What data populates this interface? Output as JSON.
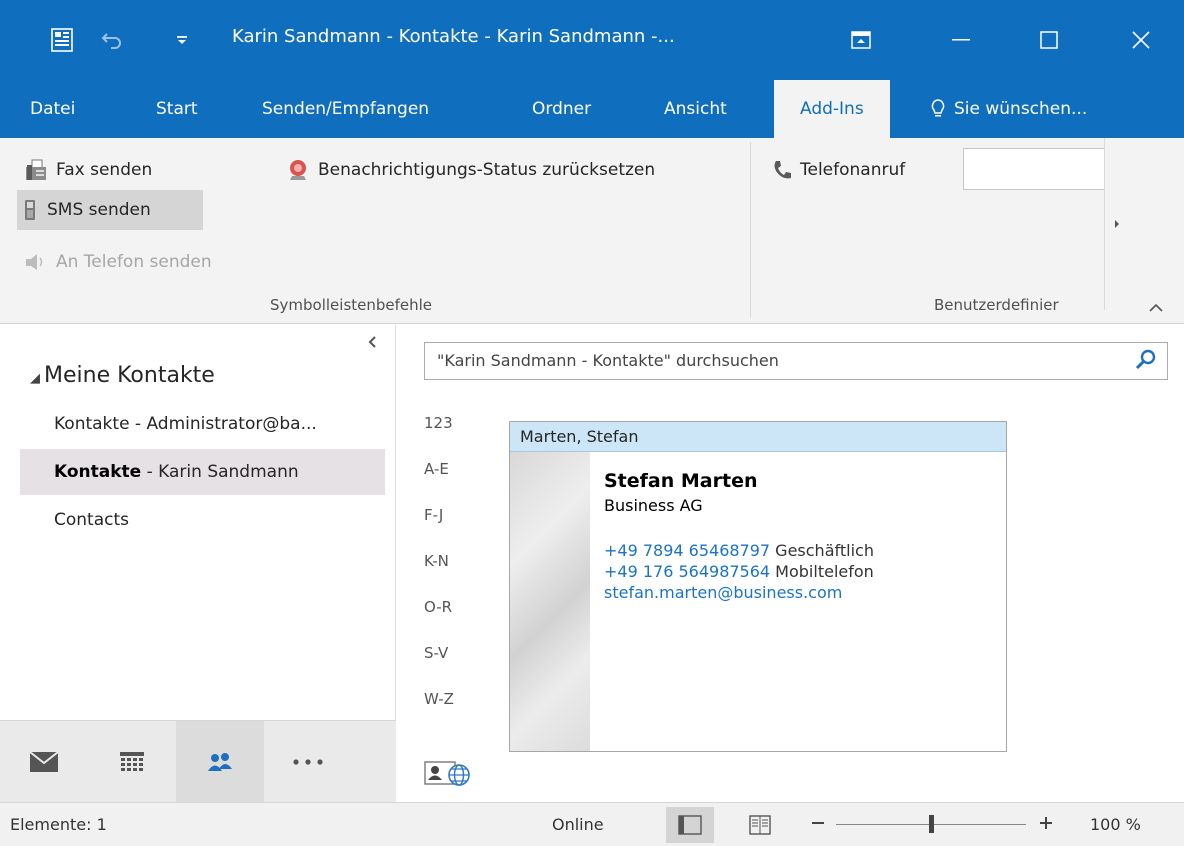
{
  "titlebar": {
    "title": "Karin Sandmann - Kontakte - Karin Sandmann -...",
    "icons": [
      "app-icon",
      "undo-icon",
      "customize-qat-icon",
      "ribbon-display-icon",
      "minimize-icon",
      "maximize-icon",
      "close-icon"
    ]
  },
  "tabs": [
    "Datei",
    "Start",
    "Senden/Empfangen",
    "Ordner",
    "Ansicht",
    "Add-Ins",
    "Sie wünschen..."
  ],
  "active_tab": "Add-Ins",
  "ribbon": {
    "fax": "Fax senden",
    "sms": "SMS senden",
    "phone": "An Telefon senden",
    "reset": "Benachrichtigungs-Status zurücksetzen",
    "call": "Telefonanruf",
    "group1": "Symbolleistenbefehle",
    "group2": "Benutzerdefinier"
  },
  "folders": {
    "heading": "Meine Kontakte",
    "items": [
      {
        "bold": "",
        "rest": "Kontakte - Administrator@ba..."
      },
      {
        "bold": "Kontakte",
        "rest": " - Karin Sandmann"
      },
      {
        "bold": "",
        "rest": "Contacts"
      }
    ]
  },
  "search": {
    "placeholder": "\"Karin Sandmann - Kontakte\" durchsuchen"
  },
  "alphabet": [
    "123",
    "A-E",
    "F-J",
    "K-N",
    "O-R",
    "S-V",
    "W-Z"
  ],
  "card": {
    "header": "Marten, Stefan",
    "name": "Stefan Marten",
    "company": "Business AG",
    "phone1": "+49 7894 65468797",
    "phone1_label": " Geschäftlich",
    "phone2": "+49 176 564987564",
    "phone2_label": " Mobiltelefon",
    "email": "stefan.marten@business.com"
  },
  "statusbar": {
    "items": "Elemente: 1",
    "connection": "Online",
    "zoom": "100 %",
    "zoom_level": 1.0
  },
  "colors": {
    "accent": "#106ebe",
    "link": "#1a73c9"
  }
}
